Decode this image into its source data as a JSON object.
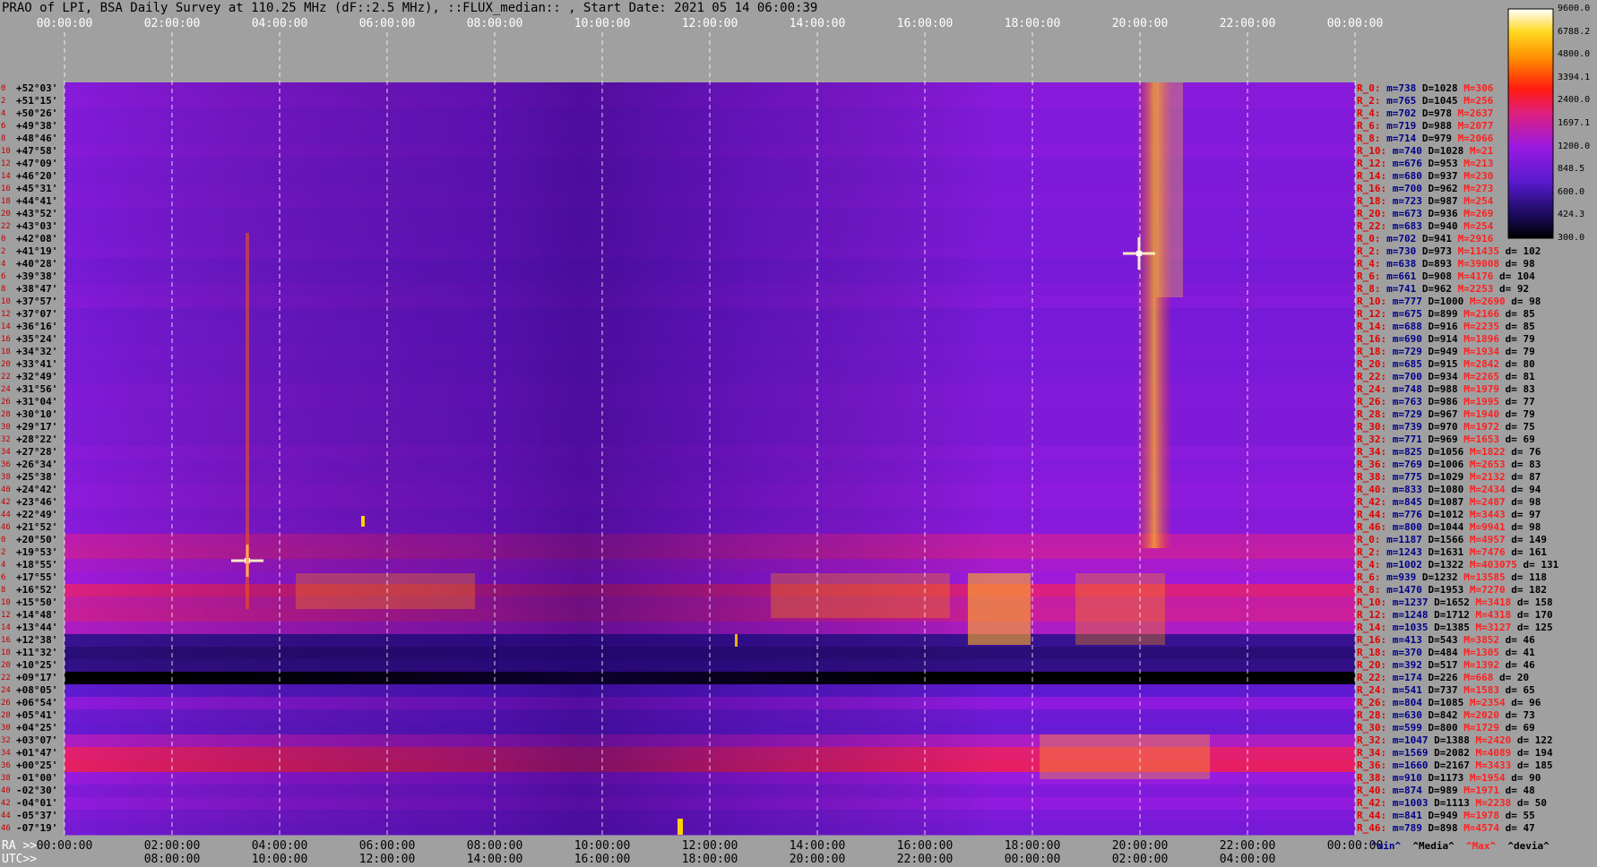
{
  "title": "PRAO of LPI, BSA Daily Survey at 110.25 MHz (dF::2.5 MHz), ::FLUX_median:: , Start Date: 2021 05 14 06:00:39",
  "time_top": [
    "00:00:00",
    "02:00:00",
    "04:00:00",
    "06:00:00",
    "08:00:00",
    "10:00:00",
    "12:00:00",
    "14:00:00",
    "16:00:00",
    "18:00:00",
    "20:00:00",
    "22:00:00",
    "00:00:00"
  ],
  "ra_axis_label": "RA >>",
  "ra_ticks": [
    "00:00:00",
    "02:00:00",
    "04:00:00",
    "06:00:00",
    "08:00:00",
    "10:00:00",
    "12:00:00",
    "14:00:00",
    "16:00:00",
    "18:00:00",
    "20:00:00",
    "22:00:00",
    "00:00:00"
  ],
  "utc_axis_label": "UTC>>",
  "utc_ticks": [
    "08:00:00",
    "10:00:00",
    "12:00:00",
    "14:00:00",
    "16:00:00",
    "18:00:00",
    "20:00:00",
    "22:00:00",
    "00:00:00",
    "02:00:00",
    "04:00:00"
  ],
  "colorbar_ticks": [
    "9600.0",
    "6788.2",
    "4800.0",
    "3394.1",
    "2400.0",
    "1697.1",
    "1200.0",
    "848.5",
    "600.0",
    "424.3",
    "300.0"
  ],
  "declinations": [
    "+52°03'",
    "+51°15'",
    "+50°26'",
    "+49°38'",
    "+48°46'",
    "+47°58'",
    "+47°09'",
    "+46°20'",
    "+45°31'",
    "+44°41'",
    "+43°52'",
    "+43°03'",
    "+42°08'",
    "+41°19'",
    "+40°28'",
    "+39°38'",
    "+38°47'",
    "+37°57'",
    "+37°07'",
    "+36°16'",
    "+35°24'",
    "+34°32'",
    "+33°41'",
    "+32°49'",
    "+31°56'",
    "+31°04'",
    "+30°10'",
    "+29°17'",
    "+28°22'",
    "+27°28'",
    "+26°34'",
    "+25°38'",
    "+24°42'",
    "+23°46'",
    "+22°49'",
    "+21°52'",
    "+20°50'",
    "+19°53'",
    "+18°55'",
    "+17°55'",
    "+16°52'",
    "+15°50'",
    "+14°48'",
    "+13°44'",
    "+12°38'",
    "+11°32'",
    "+10°25'",
    "+09°17'",
    "+08°05'",
    "+06°54'",
    "+05°41'",
    "+04°25'",
    "+03°07'",
    "+01°47'",
    "+00°25'",
    "-01°00'",
    "-02°30'",
    "-04°01'",
    "-05°37'",
    "-07°19'"
  ],
  "row_indices": [
    "0",
    "2",
    "4",
    "6",
    "8",
    "10",
    "12",
    "14",
    "16",
    "18",
    "20",
    "22",
    "0",
    "2",
    "4",
    "6",
    "8",
    "10",
    "12",
    "14",
    "16",
    "18",
    "20",
    "22",
    "24",
    "26",
    "28",
    "30",
    "32",
    "34",
    "36",
    "38",
    "40",
    "42",
    "44",
    "46",
    "0",
    "2",
    "4",
    "6",
    "8",
    "10",
    "12",
    "14",
    "16",
    "18",
    "20",
    "22",
    "24",
    "26",
    "28",
    "30",
    "32",
    "34",
    "36",
    "38",
    "40",
    "42",
    "44",
    "46"
  ],
  "stats": [
    {
      "r": "R_0:",
      "m": "m=738",
      "D": "D=1028",
      "M": "M=306",
      "d": ""
    },
    {
      "r": "R_2:",
      "m": "m=765",
      "D": "D=1045",
      "M": "M=256",
      "d": ""
    },
    {
      "r": "R_4:",
      "m": "m=702",
      "D": "D=978",
      "M": "M=2637",
      "d": ""
    },
    {
      "r": "R_6:",
      "m": "m=719",
      "D": "D=988",
      "M": "M=2077",
      "d": ""
    },
    {
      "r": "R_8:",
      "m": "m=714",
      "D": "D=979",
      "M": "M=2066",
      "d": ""
    },
    {
      "r": "R_10:",
      "m": "m=740",
      "D": "D=1028",
      "M": "M=21",
      "d": ""
    },
    {
      "r": "R_12:",
      "m": "m=676",
      "D": "D=953",
      "M": "M=213",
      "d": ""
    },
    {
      "r": "R_14:",
      "m": "m=680",
      "D": "D=937",
      "M": "M=230",
      "d": ""
    },
    {
      "r": "R_16:",
      "m": "m=700",
      "D": "D=962",
      "M": "M=273",
      "d": ""
    },
    {
      "r": "R_18:",
      "m": "m=723",
      "D": "D=987",
      "M": "M=254",
      "d": ""
    },
    {
      "r": "R_20:",
      "m": "m=673",
      "D": "D=936",
      "M": "M=269",
      "d": ""
    },
    {
      "r": "R_22:",
      "m": "m=683",
      "D": "D=940",
      "M": "M=254",
      "d": ""
    },
    {
      "r": "R_0:",
      "m": "m=702",
      "D": "D=941",
      "M": "M=2916",
      "d": ""
    },
    {
      "r": "R_2:",
      "m": "m=730",
      "D": "D=973",
      "M": "M=11435",
      "d": "d= 102"
    },
    {
      "r": "R_4:",
      "m": "m=638",
      "D": "D=893",
      "M": "M=39008",
      "d": "d= 98"
    },
    {
      "r": "R_6:",
      "m": "m=661",
      "D": "D=908",
      "M": "M=4176",
      "d": "d= 104"
    },
    {
      "r": "R_8:",
      "m": "m=741",
      "D": "D=962",
      "M": "M=2253",
      "d": "d= 92"
    },
    {
      "r": "R_10:",
      "m": "m=777",
      "D": "D=1000",
      "M": "M=2690",
      "d": "d= 98"
    },
    {
      "r": "R_12:",
      "m": "m=675",
      "D": "D=899",
      "M": "M=2166",
      "d": "d= 85"
    },
    {
      "r": "R_14:",
      "m": "m=688",
      "D": "D=916",
      "M": "M=2235",
      "d": "d= 85"
    },
    {
      "r": "R_16:",
      "m": "m=690",
      "D": "D=914",
      "M": "M=1896",
      "d": "d= 79"
    },
    {
      "r": "R_18:",
      "m": "m=729",
      "D": "D=949",
      "M": "M=1934",
      "d": "d= 79"
    },
    {
      "r": "R_20:",
      "m": "m=685",
      "D": "D=915",
      "M": "M=2842",
      "d": "d= 80"
    },
    {
      "r": "R_22:",
      "m": "m=700",
      "D": "D=934",
      "M": "M=2265",
      "d": "d= 81"
    },
    {
      "r": "R_24:",
      "m": "m=748",
      "D": "D=988",
      "M": "M=1979",
      "d": "d= 83"
    },
    {
      "r": "R_26:",
      "m": "m=763",
      "D": "D=986",
      "M": "M=1995",
      "d": "d= 77"
    },
    {
      "r": "R_28:",
      "m": "m=729",
      "D": "D=967",
      "M": "M=1940",
      "d": "d= 79"
    },
    {
      "r": "R_30:",
      "m": "m=739",
      "D": "D=970",
      "M": "M=1972",
      "d": "d= 75"
    },
    {
      "r": "R_32:",
      "m": "m=771",
      "D": "D=969",
      "M": "M=1653",
      "d": "d= 69"
    },
    {
      "r": "R_34:",
      "m": "m=825",
      "D": "D=1056",
      "M": "M=1822",
      "d": "d= 76"
    },
    {
      "r": "R_36:",
      "m": "m=769",
      "D": "D=1006",
      "M": "M=2653",
      "d": "d= 83"
    },
    {
      "r": "R_38:",
      "m": "m=775",
      "D": "D=1029",
      "M": "M=2132",
      "d": "d= 87"
    },
    {
      "r": "R_40:",
      "m": "m=833",
      "D": "D=1080",
      "M": "M=2434",
      "d": "d= 94"
    },
    {
      "r": "R_42:",
      "m": "m=845",
      "D": "D=1087",
      "M": "M=2487",
      "d": "d= 98"
    },
    {
      "r": "R_44:",
      "m": "m=776",
      "D": "D=1012",
      "M": "M=3443",
      "d": "d= 97"
    },
    {
      "r": "R_46:",
      "m": "m=800",
      "D": "D=1044",
      "M": "M=9941",
      "d": "d= 98"
    },
    {
      "r": "R_0:",
      "m": "m=1187",
      "D": "D=1566",
      "M": "M=4957",
      "d": "d= 149"
    },
    {
      "r": "R_2:",
      "m": "m=1243",
      "D": "D=1631",
      "M": "M=7476",
      "d": "d= 161"
    },
    {
      "r": "R_4:",
      "m": "m=1002",
      "D": "D=1322",
      "M": "M=403075",
      "d": "d= 131"
    },
    {
      "r": "R_6:",
      "m": "m=939",
      "D": "D=1232",
      "M": "M=13585",
      "d": "d= 118"
    },
    {
      "r": "R_8:",
      "m": "m=1470",
      "D": "D=1953",
      "M": "M=7270",
      "d": "d= 182"
    },
    {
      "r": "R_10:",
      "m": "m=1237",
      "D": "D=1652",
      "M": "M=3418",
      "d": "d= 158"
    },
    {
      "r": "R_12:",
      "m": "m=1248",
      "D": "D=1712",
      "M": "M=4318",
      "d": "d= 170"
    },
    {
      "r": "R_14:",
      "m": "m=1035",
      "D": "D=1385",
      "M": "M=3127",
      "d": "d= 125"
    },
    {
      "r": "R_16:",
      "m": "m=413",
      "D": "D=543",
      "M": "M=3852",
      "d": "d= 46"
    },
    {
      "r": "R_18:",
      "m": "m=370",
      "D": "D=484",
      "M": "M=1305",
      "d": "d= 41"
    },
    {
      "r": "R_20:",
      "m": "m=392",
      "D": "D=517",
      "M": "M=1392",
      "d": "d= 46"
    },
    {
      "r": "R_22:",
      "m": "m=174",
      "D": "D=226",
      "M": "M=668",
      "d": "d= 20"
    },
    {
      "r": "R_24:",
      "m": "m=541",
      "D": "D=737",
      "M": "M=1583",
      "d": "d= 65"
    },
    {
      "r": "R_26:",
      "m": "m=804",
      "D": "D=1085",
      "M": "M=2354",
      "d": "d= 96"
    },
    {
      "r": "R_28:",
      "m": "m=630",
      "D": "D=842",
      "M": "M=2020",
      "d": "d= 73"
    },
    {
      "r": "R_30:",
      "m": "m=599",
      "D": "D=800",
      "M": "M=1729",
      "d": "d= 69"
    },
    {
      "r": "R_32:",
      "m": "m=1047",
      "D": "D=1388",
      "M": "M=2420",
      "d": "d= 122"
    },
    {
      "r": "R_34:",
      "m": "m=1569",
      "D": "D=2082",
      "M": "M=4089",
      "d": "d= 194"
    },
    {
      "r": "R_36:",
      "m": "m=1660",
      "D": "D=2167",
      "M": "M=3433",
      "d": "d= 185"
    },
    {
      "r": "R_38:",
      "m": "m=910",
      "D": "D=1173",
      "M": "M=1954",
      "d": "d= 90"
    },
    {
      "r": "R_40:",
      "m": "m=874",
      "D": "D=989",
      "M": "M=1971",
      "d": "d= 48"
    },
    {
      "r": "R_42:",
      "m": "m=1003",
      "D": "D=1113",
      "M": "M=2238",
      "d": "d= 50"
    },
    {
      "r": "R_44:",
      "m": "m=841",
      "D": "D=949",
      "M": "M=1978",
      "d": "d= 55"
    },
    {
      "r": "R_46:",
      "m": "m=789",
      "D": "D=898",
      "M": "M=4574",
      "d": "d= 47"
    }
  ],
  "legend": {
    "min": "^min^",
    "median": "^Media^",
    "max": "^Max^",
    "dev": "^devia^"
  },
  "colors": {
    "min": "#00008b",
    "median": "#000000",
    "max": "#ff2020",
    "dev": "#000000",
    "index": "#e00000"
  },
  "chart_data": {
    "type": "heatmap",
    "title": "PRAO of LPI, BSA Daily Survey at 110.25 MHz (dF::2.5 MHz), ::FLUX_median:: , Start Date: 2021 05 14 06:00:39",
    "x_ticks_ra": [
      "00:00:00",
      "02:00:00",
      "04:00:00",
      "06:00:00",
      "08:00:00",
      "10:00:00",
      "12:00:00",
      "14:00:00",
      "16:00:00",
      "18:00:00",
      "20:00:00",
      "22:00:00",
      "00:00:00"
    ],
    "x_ticks_utc": [
      "08:00:00",
      "10:00:00",
      "12:00:00",
      "14:00:00",
      "16:00:00",
      "18:00:00",
      "20:00:00",
      "22:00:00",
      "00:00:00",
      "02:00:00",
      "04:00:00"
    ],
    "y_ticks": "declinations",
    "color_scale": [
      300,
      424.3,
      600,
      848.5,
      1200,
      1697.1,
      2400,
      3394.1,
      4800,
      6788.2,
      9600
    ],
    "color_scale_type": "log",
    "grid": true,
    "row_median_flux": [
      1028,
      1045,
      978,
      988,
      979,
      1028,
      953,
      937,
      962,
      987,
      936,
      940,
      941,
      973,
      893,
      908,
      962,
      1000,
      899,
      916,
      914,
      949,
      915,
      934,
      988,
      986,
      967,
      970,
      969,
      1056,
      1006,
      1029,
      1080,
      1087,
      1012,
      1044,
      1566,
      1631,
      1322,
      1232,
      1953,
      1652,
      1712,
      1385,
      543,
      484,
      517,
      226,
      737,
      1085,
      842,
      800,
      1388,
      2082,
      2167,
      1173,
      989,
      1113,
      949,
      898
    ]
  }
}
